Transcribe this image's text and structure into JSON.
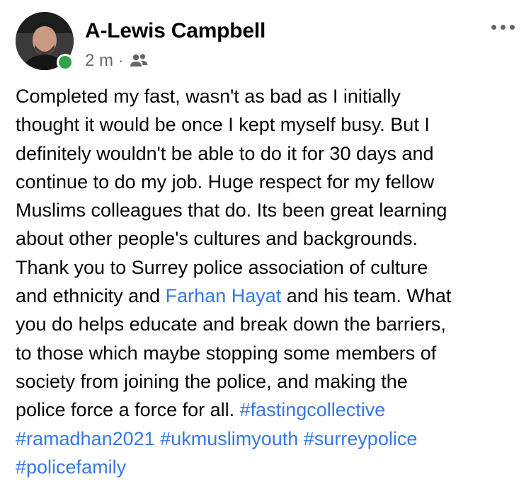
{
  "author": {
    "name": "A-Lewis Campbell",
    "avatar_icon": "profile-photo",
    "online_status_color": "#31a24c"
  },
  "meta": {
    "time": "2 m",
    "separator": "·",
    "audience_icon": "friends-icon"
  },
  "more_icon": "ellipsis-icon",
  "colors": {
    "link": "#3578e5",
    "text": "#050505",
    "meta": "#65676b"
  },
  "post": {
    "line1": "Completed my fast, wasn't as bad as I initially",
    "line2": "thought it would be once I kept myself busy. But I",
    "line3": "definitely wouldn't be able to do it for 30 days and",
    "line4": "continue to do my job. Huge respect for my fellow",
    "line5": "Muslims colleagues that do. Its been great learning",
    "line6": "about other people's cultures and backgrounds.",
    "line7": "Thank you to Surrey police association of culture",
    "line8_before": "and ethnicity and ",
    "mention": "Farhan Hayat",
    "line8_after": " and his team. What",
    "line9": "you do helps educate and break down the barriers,",
    "line10": "to those which maybe stopping some members of",
    "line11": "society from joining the police, and making the",
    "line12_text": "police force a force for all. ",
    "hashtags": {
      "fastingcollective": "#fastingcollective",
      "ramadhan2021": "#ramadhan2021",
      "ukmuslimyouth": "#ukmuslimyouth",
      "surreypolice": "#surreypolice",
      "policefamily": "#policefamily"
    }
  }
}
